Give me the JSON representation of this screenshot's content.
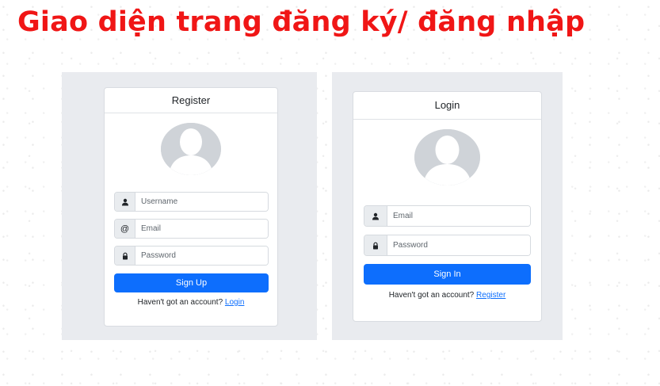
{
  "title": "Giao diện trang đăng ký/ đăng nhập",
  "register": {
    "header": "Register",
    "username_placeholder": "Username",
    "email_placeholder": "Email",
    "password_placeholder": "Password",
    "email_addon": "@",
    "button": "Sign Up",
    "footer_text": "Haven't got an account?",
    "footer_link": "Login"
  },
  "login": {
    "header": "Login",
    "email_placeholder": "Email",
    "password_placeholder": "Password",
    "button": "Sign In",
    "footer_text": "Haven't got an account?",
    "footer_link": "Register"
  },
  "colors": {
    "title": "#f01616",
    "primary": "#0d6efd",
    "panel": "#e9ebef"
  }
}
